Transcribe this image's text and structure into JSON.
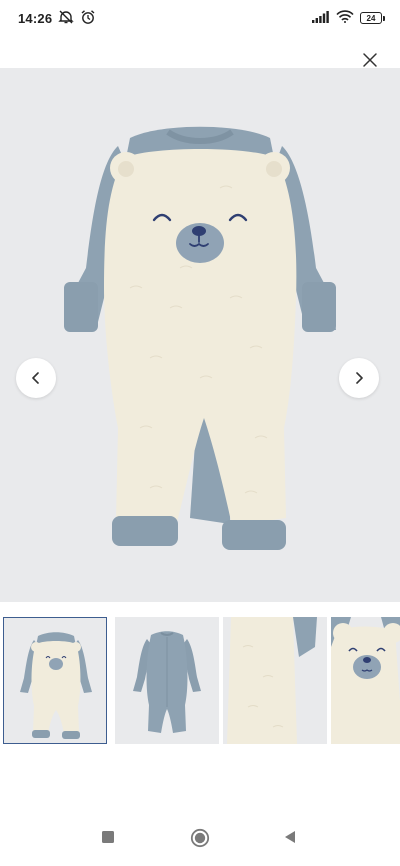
{
  "status_bar": {
    "time": "14:26",
    "battery_level": "24",
    "icons": [
      "muted-notification-icon",
      "alarm-icon",
      "signal-icon",
      "wifi-icon",
      "battery-icon"
    ]
  },
  "viewer": {
    "close_icon": "close-icon",
    "prev_icon": "chevron-left-icon",
    "next_icon": "chevron-right-icon",
    "active_index": 0,
    "thumbnails": [
      {
        "view": "front-full"
      },
      {
        "view": "back-full"
      },
      {
        "view": "detail-leg"
      },
      {
        "view": "detail-face"
      }
    ]
  },
  "system_nav": {
    "icons": [
      "recents-square-icon",
      "home-circle-icon",
      "back-triangle-icon"
    ]
  },
  "colors": {
    "fleece": "#f1ecdc",
    "sleeve_blue": "#8ea2b2",
    "face_patch": "#90a3b5",
    "embroidery": "#2f3f72",
    "background": "#e9eaec",
    "active_border": "#3d5d8f"
  }
}
